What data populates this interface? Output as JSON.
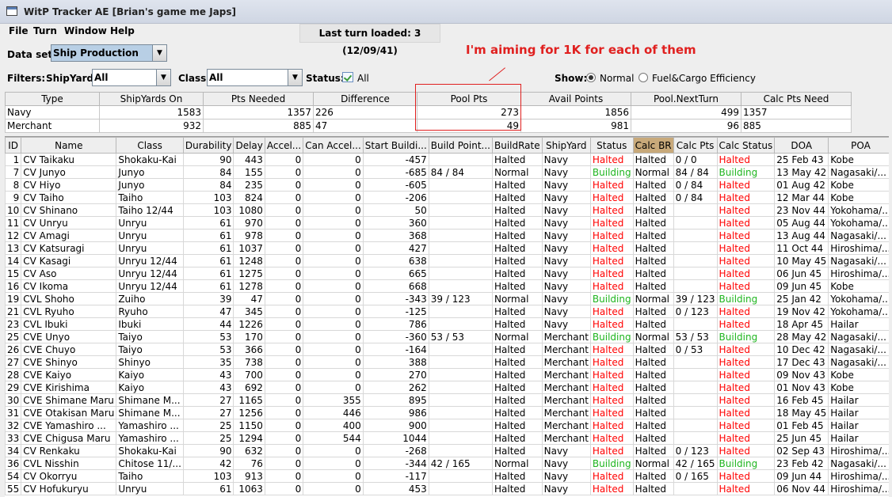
{
  "window": {
    "title": "WitP Tracker AE [Brian's game me Japs]"
  },
  "menu": [
    "File",
    "Turn",
    "Window",
    "Help"
  ],
  "last_turn": "Last turn loaded: 3 (12/09/41)",
  "dataset": {
    "label": "Data set:",
    "value": "Ship Production"
  },
  "filters": {
    "label": "Filters:",
    "shipyard_label": "ShipYard:",
    "shipyard_value": "All",
    "class_label": "Class:",
    "class_value": "All",
    "status_label": "Status:",
    "status_value": "All"
  },
  "show": {
    "label": "Show:",
    "options": [
      "Normal",
      "Fuel&Cargo Efficiency"
    ],
    "selected": "Normal"
  },
  "annotation": "I'm aiming for 1K for each of them",
  "summary": {
    "headers": [
      "Type",
      "ShipYards On",
      "Pts Needed",
      "Difference",
      "Pool Pts",
      "Avail Points",
      "Pool.NextTurn",
      "Calc Pts Need"
    ],
    "rows": [
      [
        "Navy",
        "1583",
        "1357",
        "226",
        "273",
        "1856",
        "499",
        "1357"
      ],
      [
        "Merchant",
        "932",
        "885",
        "47",
        "49",
        "981",
        "96",
        "885"
      ]
    ]
  },
  "table": {
    "headers": [
      "ID",
      "Name",
      "Class",
      "Durability",
      "Delay",
      "Accel...",
      "Can Accel...",
      "Start Buildi...",
      "Build Point...",
      "BuildRate",
      "ShipYard",
      "Status",
      "Calc BR",
      "Calc Pts",
      "Calc Status",
      "DOA",
      "POA"
    ],
    "rows": [
      [
        "1",
        "CV Taikaku",
        "Shokaku-Kai",
        "90",
        "443",
        "0",
        "0",
        "-457",
        "",
        "Halted",
        "Navy",
        "Halted",
        "Halted",
        "0 / 0",
        "Halted",
        "25 Feb 43",
        "Kobe"
      ],
      [
        "7",
        "CV Junyo",
        "Junyo",
        "84",
        "155",
        "0",
        "0",
        "-685",
        "84 / 84",
        "Normal",
        "Navy",
        "Building",
        "Normal",
        "84 / 84",
        "Building",
        "13 May 42",
        "Nagasaki/..."
      ],
      [
        "8",
        "CV Hiyo",
        "Junyo",
        "84",
        "235",
        "0",
        "0",
        "-605",
        "",
        "Halted",
        "Navy",
        "Halted",
        "Halted",
        "0 / 84",
        "Halted",
        "01 Aug 42",
        "Kobe"
      ],
      [
        "9",
        "CV Taiho",
        "Taiho",
        "103",
        "824",
        "0",
        "0",
        "-206",
        "",
        "Halted",
        "Navy",
        "Halted",
        "Halted",
        "0 / 84",
        "Halted",
        "12 Mar 44",
        "Kobe"
      ],
      [
        "10",
        "CV Shinano",
        "Taiho 12/44",
        "103",
        "1080",
        "0",
        "0",
        "50",
        "",
        "Halted",
        "Navy",
        "Halted",
        "Halted",
        "",
        "Halted",
        "23 Nov 44",
        "Yokohama/..."
      ],
      [
        "11",
        "CV Unryu",
        "Unryu",
        "61",
        "970",
        "0",
        "0",
        "360",
        "",
        "Halted",
        "Navy",
        "Halted",
        "Halted",
        "",
        "Halted",
        "05 Aug 44",
        "Yokohama/..."
      ],
      [
        "12",
        "CV Amagi",
        "Unryu",
        "61",
        "978",
        "0",
        "0",
        "368",
        "",
        "Halted",
        "Navy",
        "Halted",
        "Halted",
        "",
        "Halted",
        "13 Aug 44",
        "Nagasaki/..."
      ],
      [
        "13",
        "CV Katsuragi",
        "Unryu",
        "61",
        "1037",
        "0",
        "0",
        "427",
        "",
        "Halted",
        "Navy",
        "Halted",
        "Halted",
        "",
        "Halted",
        "11 Oct 44",
        "Hiroshima/..."
      ],
      [
        "14",
        "CV Kasagi",
        "Unryu 12/44",
        "61",
        "1248",
        "0",
        "0",
        "638",
        "",
        "Halted",
        "Navy",
        "Halted",
        "Halted",
        "",
        "Halted",
        "10 May 45",
        "Nagasaki/..."
      ],
      [
        "15",
        "CV Aso",
        "Unryu 12/44",
        "61",
        "1275",
        "0",
        "0",
        "665",
        "",
        "Halted",
        "Navy",
        "Halted",
        "Halted",
        "",
        "Halted",
        "06 Jun 45",
        "Hiroshima/..."
      ],
      [
        "16",
        "CV Ikoma",
        "Unryu 12/44",
        "61",
        "1278",
        "0",
        "0",
        "668",
        "",
        "Halted",
        "Navy",
        "Halted",
        "Halted",
        "",
        "Halted",
        "09 Jun 45",
        "Kobe"
      ],
      [
        "19",
        "CVL Shoho",
        "Zuiho",
        "39",
        "47",
        "0",
        "0",
        "-343",
        "39 / 123",
        "Normal",
        "Navy",
        "Building",
        "Normal",
        "39 / 123",
        "Building",
        "25 Jan 42",
        "Yokohama/..."
      ],
      [
        "21",
        "CVL Ryuho",
        "Ryuho",
        "47",
        "345",
        "0",
        "0",
        "-125",
        "",
        "Halted",
        "Navy",
        "Halted",
        "Halted",
        "0 / 123",
        "Halted",
        "19 Nov 42",
        "Yokohama/..."
      ],
      [
        "23",
        "CVL Ibuki",
        "Ibuki",
        "44",
        "1226",
        "0",
        "0",
        "786",
        "",
        "Halted",
        "Navy",
        "Halted",
        "Halted",
        "",
        "Halted",
        "18 Apr 45",
        "Hailar"
      ],
      [
        "25",
        "CVE Unyo",
        "Taiyo",
        "53",
        "170",
        "0",
        "0",
        "-360",
        "53 / 53",
        "Normal",
        "Merchant",
        "Building",
        "Normal",
        "53 / 53",
        "Building",
        "28 May 42",
        "Nagasaki/..."
      ],
      [
        "26",
        "CVE Chuyo",
        "Taiyo",
        "53",
        "366",
        "0",
        "0",
        "-164",
        "",
        "Halted",
        "Merchant",
        "Halted",
        "Halted",
        "0 / 53",
        "Halted",
        "10 Dec 42",
        "Nagasaki/..."
      ],
      [
        "27",
        "CVE Shinyo",
        "Shinyo",
        "35",
        "738",
        "0",
        "0",
        "388",
        "",
        "Halted",
        "Merchant",
        "Halted",
        "Halted",
        "",
        "Halted",
        "17 Dec 43",
        "Nagasaki/..."
      ],
      [
        "28",
        "CVE Kaiyo",
        "Kaiyo",
        "43",
        "700",
        "0",
        "0",
        "270",
        "",
        "Halted",
        "Merchant",
        "Halted",
        "Halted",
        "",
        "Halted",
        "09 Nov 43",
        "Kobe"
      ],
      [
        "29",
        "CVE Kirishima",
        "Kaiyo",
        "43",
        "692",
        "0",
        "0",
        "262",
        "",
        "Halted",
        "Merchant",
        "Halted",
        "Halted",
        "",
        "Halted",
        "01 Nov 43",
        "Kobe"
      ],
      [
        "30",
        "CVE Shimane Maru",
        "Shimane M...",
        "27",
        "1165",
        "0",
        "355",
        "895",
        "",
        "Halted",
        "Merchant",
        "Halted",
        "Halted",
        "",
        "Halted",
        "16 Feb 45",
        "Hailar"
      ],
      [
        "31",
        "CVE Otakisan Maru",
        "Shimane M...",
        "27",
        "1256",
        "0",
        "446",
        "986",
        "",
        "Halted",
        "Merchant",
        "Halted",
        "Halted",
        "",
        "Halted",
        "18 May 45",
        "Hailar"
      ],
      [
        "32",
        "CVE Yamashiro ...",
        "Yamashiro ...",
        "25",
        "1150",
        "0",
        "400",
        "900",
        "",
        "Halted",
        "Merchant",
        "Halted",
        "Halted",
        "",
        "Halted",
        "01 Feb 45",
        "Hailar"
      ],
      [
        "33",
        "CVE Chigusa Maru",
        "Yamashiro ...",
        "25",
        "1294",
        "0",
        "544",
        "1044",
        "",
        "Halted",
        "Merchant",
        "Halted",
        "Halted",
        "",
        "Halted",
        "25 Jun 45",
        "Hailar"
      ],
      [
        "34",
        "CV Renkaku",
        "Shokaku-Kai",
        "90",
        "632",
        "0",
        "0",
        "-268",
        "",
        "Halted",
        "Navy",
        "Halted",
        "Halted",
        "0 / 123",
        "Halted",
        "02 Sep 43",
        "Hiroshima/..."
      ],
      [
        "36",
        "CVL Nisshin",
        "Chitose 11/...",
        "42",
        "76",
        "0",
        "0",
        "-344",
        "42 / 165",
        "Normal",
        "Navy",
        "Building",
        "Normal",
        "42 / 165",
        "Building",
        "23 Feb 42",
        "Nagasaki/..."
      ],
      [
        "54",
        "CV Okorryu",
        "Taiho",
        "103",
        "913",
        "0",
        "0",
        "-117",
        "",
        "Halted",
        "Navy",
        "Halted",
        "Halted",
        "0 / 165",
        "Halted",
        "09 Jun 44",
        "Hiroshima/..."
      ],
      [
        "55",
        "CV Hofukuryu",
        "Unryu",
        "61",
        "1063",
        "0",
        "0",
        "453",
        "",
        "Halted",
        "Navy",
        "Halted",
        "Halted",
        "",
        "Halted",
        "06 Nov 44",
        "Hiroshima/..."
      ]
    ]
  },
  "colors": {
    "halted": "#ff0000",
    "building": "#1fb51f",
    "highlight_header": "#c8a97a",
    "annotation": "#e0201f"
  }
}
